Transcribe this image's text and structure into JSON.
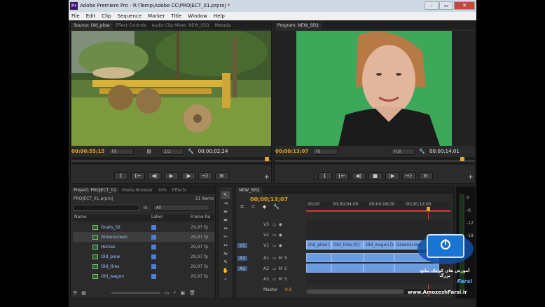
{
  "window": {
    "title": "Adobe Premiere Pro - R:\\Temp\\Adobe CC\\PROJECT_01.prproj *"
  },
  "menu": [
    "File",
    "Edit",
    "Clip",
    "Sequence",
    "Marker",
    "Title",
    "Window",
    "Help"
  ],
  "source_panel": {
    "tabs": [
      "Source: Old_plow",
      "Effect Controls",
      "Audio Clip Mixer: NEW_SEQ",
      "Metada"
    ],
    "timecode_in": "00;00;55;15",
    "zoom": "Fit",
    "resolution": "1/2",
    "duration": "00;00;02;24"
  },
  "program_panel": {
    "tabs": [
      "Program: NEW_SEQ"
    ],
    "timecode": "00;00;13;07",
    "zoom": "Fit",
    "resolution": "Full",
    "duration": "00;00;14;01"
  },
  "project_panel": {
    "tabs": [
      "Project: PROJECT_01",
      "Media Browser",
      "Info",
      "Effects"
    ],
    "project_file": "PROJECT_01.prproj",
    "item_count": "21 Items",
    "search_placeholder": "",
    "in_label": "In:",
    "in_value": "All",
    "columns": [
      "Name",
      "Label",
      "Frame Ra"
    ],
    "items": [
      {
        "name": "Goats_02",
        "fps": "29,97 fp"
      },
      {
        "name": "Greenscreen",
        "fps": "29,97 fp"
      },
      {
        "name": "Horses",
        "fps": "29,97 fp"
      },
      {
        "name": "Old_plow",
        "fps": "29,97 fp"
      },
      {
        "name": "Old_tires",
        "fps": "29,97 fp"
      },
      {
        "name": "Old_wagon",
        "fps": "29,97 fp"
      }
    ]
  },
  "timeline": {
    "tab": "NEW_SEQ",
    "timecode": "00;00;13;07",
    "ruler": [
      "00;00",
      "00;00;04;00",
      "00;00;08;00",
      "00;00;12;00"
    ],
    "video_tracks": [
      "V3",
      "V2",
      "V1"
    ],
    "audio_tracks": [
      "A1",
      "A2",
      "A3"
    ],
    "source_patch_v": "V1",
    "source_patch_a": [
      "A1",
      "A2"
    ],
    "master_label": "Master",
    "master_value": "0.0",
    "clips": [
      "Old_plow [V]",
      "Old_tires [V]",
      "Old_wagon [V]",
      "Greenscreen"
    ]
  },
  "meter_labels": [
    "0",
    "-6",
    "-12",
    "-18"
  ],
  "watermark": {
    "persian_line": "آموزش های کوچک نتایج بزرگ",
    "brand": "AmozeshFarsi",
    "brand_suffix": "Farsi",
    "url": "www.AmozeshFarsi.ir"
  },
  "colors": {
    "timecode": "#e5a21d",
    "clip": "#7aa6e6",
    "playhead": "#e8a430"
  }
}
